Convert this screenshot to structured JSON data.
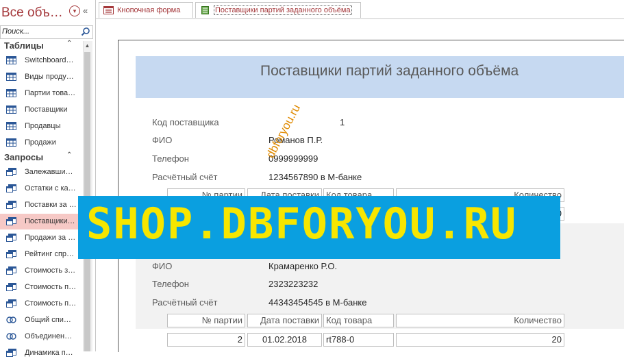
{
  "nav": {
    "title": "Все объ…",
    "search_placeholder": "Поиск...",
    "groups": [
      {
        "label": "Таблицы",
        "items": [
          {
            "label": "Switchboard…",
            "icon": "table-icon"
          },
          {
            "label": "Виды проду…",
            "icon": "table-icon"
          },
          {
            "label": "Партии това…",
            "icon": "table-icon"
          },
          {
            "label": "Поставщики",
            "icon": "table-icon"
          },
          {
            "label": "Продавцы",
            "icon": "table-icon"
          },
          {
            "label": "Продажи",
            "icon": "table-icon"
          }
        ]
      },
      {
        "label": "Запросы",
        "items": [
          {
            "label": "Залежавши…",
            "icon": "query-icon"
          },
          {
            "label": "Остатки с ка…",
            "icon": "query-icon"
          },
          {
            "label": "Поставки за …",
            "icon": "query-icon"
          },
          {
            "label": "Поставщики…",
            "icon": "query-icon",
            "selected": true
          },
          {
            "label": "Продажи за …",
            "icon": "query-icon"
          },
          {
            "label": "Рейтинг спр…",
            "icon": "query-icon"
          },
          {
            "label": "Стоимость з…",
            "icon": "query-icon"
          },
          {
            "label": "Стоимость п…",
            "icon": "query-icon"
          },
          {
            "label": "Стоимость п…",
            "icon": "query-icon"
          },
          {
            "label": "Общий спи…",
            "icon": "union-query-icon"
          },
          {
            "label": "Объединен…",
            "icon": "union-query-icon"
          },
          {
            "label": "Динамика п…",
            "icon": "query-icon"
          }
        ]
      }
    ]
  },
  "tabs": [
    {
      "label": "Кнопочная форма",
      "icon": "form-icon",
      "active": false
    },
    {
      "label": "Поставщики партий заданного объёма",
      "icon": "report-icon",
      "active": true
    }
  ],
  "report": {
    "title": "Поставщики партий заданного объёма",
    "field_labels": {
      "code": "Код поставщика",
      "fio": "ФИО",
      "phone": "Телефон",
      "account": "Расчётный счёт"
    },
    "columns": [
      "№ партии",
      "Дата поставки",
      "Код товара",
      "Количество"
    ],
    "records": [
      {
        "code": "1",
        "fio": "Романов П.Р.",
        "phone": "0999999999",
        "account": "1234567890 в М-банке",
        "rows": [
          {
            "batch": "",
            "date": "",
            "product": "",
            "qty": "0"
          }
        ]
      },
      {
        "fio": "Крамаренко Р.О.",
        "phone": "2323223232",
        "account": "44343454545 в М-банке",
        "rows": [
          {
            "batch": "2",
            "date": "01.02.2018",
            "product": "rt788-0",
            "qty": "20"
          }
        ]
      }
    ]
  },
  "watermarks": {
    "diagonal": "dbforyou.ru",
    "banner": "SHOP.DBFORYOU.RU"
  },
  "colors": {
    "accent": "#a4373a",
    "selected_item": "#f6c9c6",
    "report_header": "#c6d9f1",
    "banner_bg": "#0a9fe0",
    "banner_text": "#f7e600",
    "diagonal_watermark": "#e08a00"
  }
}
